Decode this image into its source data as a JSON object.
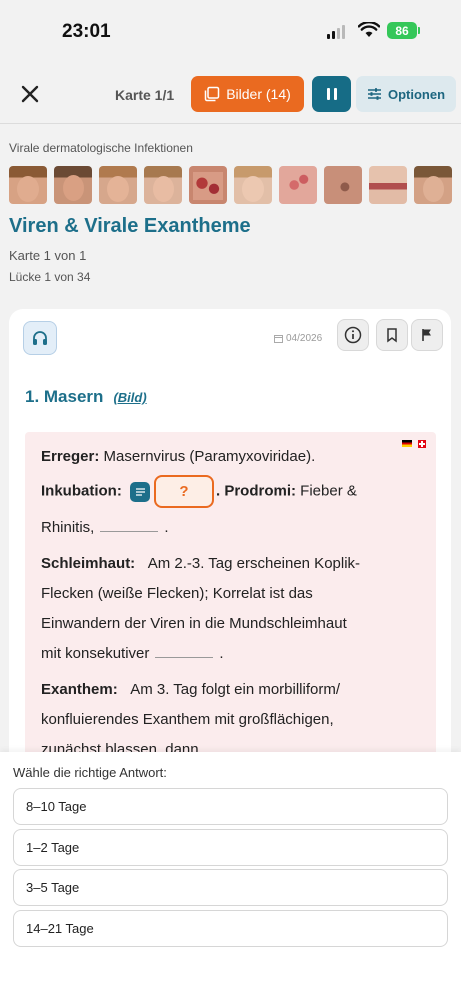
{
  "status_bar": {
    "time": "23:01",
    "battery": "86"
  },
  "toolbar": {
    "card_count": "Karte 1/1",
    "images_label": "Bilder (14)",
    "options_label": "Optionen"
  },
  "header": {
    "category": "Virale dermatologische Infektionen",
    "title": "Viren & Virale Exantheme",
    "card_of": "Karte 1 von 1",
    "gap_of": "Lücke 1 von 34"
  },
  "card": {
    "date": "04/2026",
    "section_title": "1. Masern",
    "section_link": "(Bild)",
    "answer_placeholder": "?",
    "lines": {
      "l1_label": "Erreger:",
      "l1_text": " Masernvirus (Paramyxoviridae).",
      "l2_label": "Inkubation:",
      "l2_label2": ". Prodromi:",
      "l2_text": " Fieber &",
      "l3_text": "Rhinitis,",
      "l3_end": ".",
      "l4_label": "Schleimhaut:",
      "l4_text": "Am 2.-3. Tag erscheinen Koplik-",
      "l5_text": "Flecken (weiße Flecken); Korrelat ist das",
      "l6_text": "Einwandern der Viren in die Mundschleimhaut",
      "l7_text": "mit konsekutiver",
      "l7_end": ".",
      "l8_label": "Exanthem:",
      "l8_text": "Am 3. Tag folgt ein morbilliform/",
      "l9_text": "konfluierendes Exanthem mit großflächigen,",
      "l10_text": "zunächst blassen, dann"
    }
  },
  "answers": {
    "prompt": "Wähle die richtige Antwort:",
    "options": [
      "8–10 Tage",
      "1–2 Tage",
      "3–5 Tage",
      "14–21 Tage"
    ]
  },
  "colors": {
    "accent_orange": "#ea6a20",
    "accent_teal": "#166c86",
    "title_teal": "#1d6f8a"
  }
}
